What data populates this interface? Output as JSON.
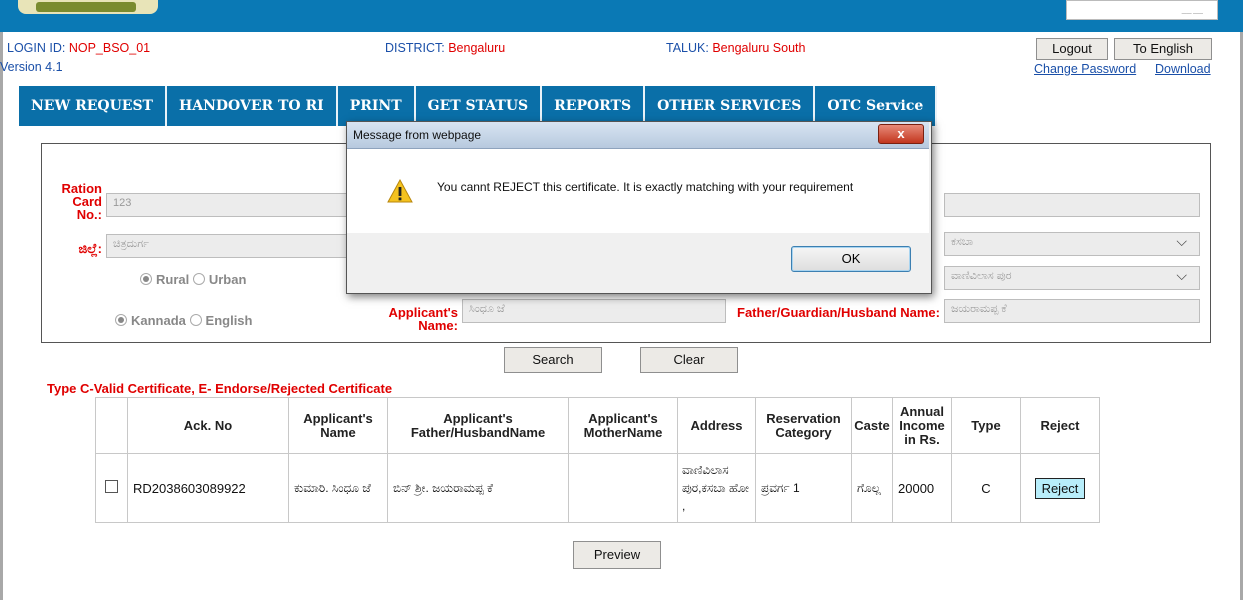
{
  "header": {
    "login_label": "LOGIN ID:",
    "login_value": "NOP_BSO_01",
    "version": "Version 4.1",
    "district_label": "DISTRICT:",
    "district_value": "Bengaluru",
    "taluk_label": "TALUK:",
    "taluk_value": "Bengaluru South",
    "logout": "Logout",
    "to_english": "To English",
    "change_password": "Change Password",
    "download": "Download"
  },
  "nav": [
    "NEW REQUEST",
    "HANDOVER TO RI",
    "PRINT",
    "GET STATUS",
    "REPORTS",
    "OTHER SERVICES",
    "OTC Service"
  ],
  "form": {
    "ration_label": "Ration Card No.:",
    "ration_value": "123",
    "district_label": "ಜಿಲ್ಲೆ:",
    "district_value": "ಚಿತ್ರದುರ್ಗ",
    "right_field1": "",
    "right_field2": "ಕಸಬಾ",
    "right_field3": "ವಾಣಿವಿಲಾಸ ಪುರ",
    "rural": "Rural",
    "urban": "Urban",
    "kannada": "Kannada",
    "english": "English",
    "applicant_label": "Applicant's Name:",
    "applicant_value": "ಸಿಂಧೂ ಜೆ",
    "father_label": "Father/Guardian/Husband Name:",
    "father_value": "ಜಯರಾಮಪ್ಪ ಕೆ",
    "search": "Search",
    "clear": "Clear"
  },
  "legend": "Type C-Valid Certificate, E- Endorse/Rejected Certificate",
  "table": {
    "headers": [
      "Ack. No",
      "Applicant's Name",
      "Applicant's Father/HusbandName",
      "Applicant's MotherName",
      "Address",
      "Reservation Category",
      "Caste",
      "Annual Income in Rs.",
      "Type",
      "Reject"
    ],
    "row": {
      "ack": "RD2038603089922",
      "name": "ಕುಮಾರಿ. ಸಿಂಧೂ ಜೆ",
      "father": "ಬಿನ್ ಶ್ರೀ. ಜಯರಾಮಪ್ಪ ಕೆ",
      "mother": "",
      "address": "ವಾಣಿವಿಲಾಸ ಪುರ,ಕಸಬಾ ಹೋ ,",
      "category": "ಪ್ರವರ್ಗ 1",
      "caste": "ಗೊಲ್ಲ",
      "income": "20000",
      "type": "C",
      "reject": "Reject"
    }
  },
  "preview": "Preview",
  "dialog": {
    "title": "Message from webpage",
    "message": "You cannt REJECT this certificate. It is exactly matching with your requirement",
    "ok": "OK",
    "close": "x"
  }
}
